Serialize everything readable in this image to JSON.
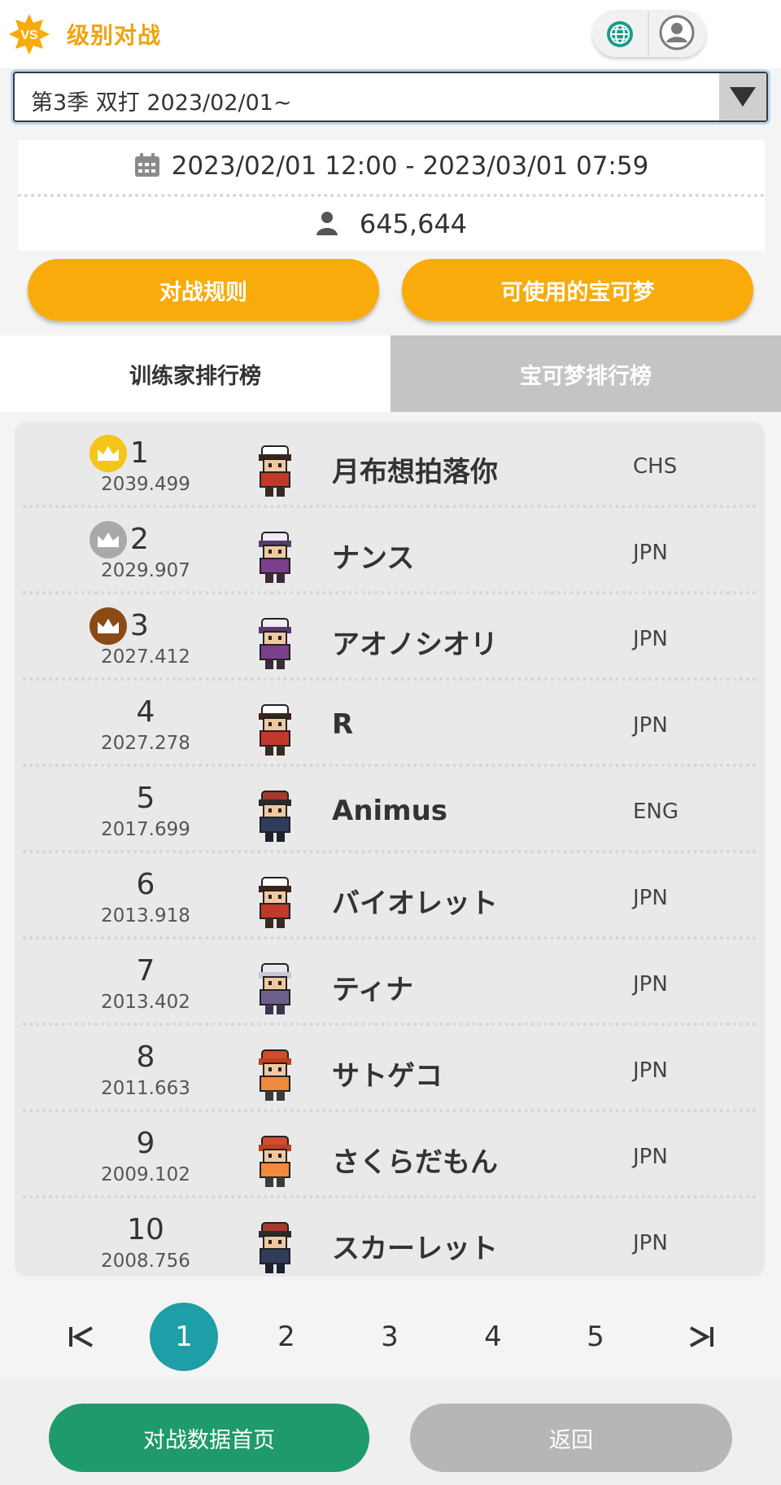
{
  "header": {
    "title": "级别对战",
    "vs_label": "VS",
    "accent_color": "#f8ab0a"
  },
  "season": {
    "selected": "第3季 双打 2023/02/01~"
  },
  "info": {
    "date_range": "2023/02/01 12:00 - 2023/03/01 07:59",
    "players": "645,644"
  },
  "buttons": {
    "rules": "对战规则",
    "usable_pokemon": "可使用的宝可梦"
  },
  "tabs": [
    {
      "label": "训练家排行榜",
      "active": true
    },
    {
      "label": "宝可梦排行榜",
      "active": false
    }
  ],
  "ranking": [
    {
      "rank": "1",
      "score": "2039.499",
      "name": "月布想拍落你",
      "lang": "CHS",
      "crown": "gold",
      "avatar": "red-trainer"
    },
    {
      "rank": "2",
      "score": "2029.907",
      "name": "ナンス",
      "lang": "JPN",
      "crown": "silver",
      "avatar": "purple-trainer"
    },
    {
      "rank": "3",
      "score": "2027.412",
      "name": "アオノシオリ",
      "lang": "JPN",
      "crown": "bronze",
      "avatar": "purple-trainer"
    },
    {
      "rank": "4",
      "score": "2027.278",
      "name": "R",
      "lang": "JPN",
      "crown": "",
      "avatar": "red-trainer"
    },
    {
      "rank": "5",
      "score": "2017.699",
      "name": "Animus",
      "lang": "ENG",
      "crown": "",
      "avatar": "dark-trainer"
    },
    {
      "rank": "6",
      "score": "2013.918",
      "name": "バイオレット",
      "lang": "JPN",
      "crown": "",
      "avatar": "red-trainer"
    },
    {
      "rank": "7",
      "score": "2013.402",
      "name": "ティナ",
      "lang": "JPN",
      "crown": "",
      "avatar": "white-trainer"
    },
    {
      "rank": "8",
      "score": "2011.663",
      "name": "サトゲコ",
      "lang": "JPN",
      "crown": "",
      "avatar": "orange-trainer"
    },
    {
      "rank": "9",
      "score": "2009.102",
      "name": "さくらだもん",
      "lang": "JPN",
      "crown": "",
      "avatar": "orange-trainer"
    },
    {
      "rank": "10",
      "score": "2008.756",
      "name": "スカーレット",
      "lang": "JPN",
      "crown": "",
      "avatar": "dark-trainer"
    }
  ],
  "pagination": {
    "first": "|<",
    "pages": [
      "1",
      "2",
      "3",
      "4",
      "5"
    ],
    "current": "1",
    "last": ">|"
  },
  "footer": {
    "home": "对战数据首页",
    "back": "返回"
  }
}
